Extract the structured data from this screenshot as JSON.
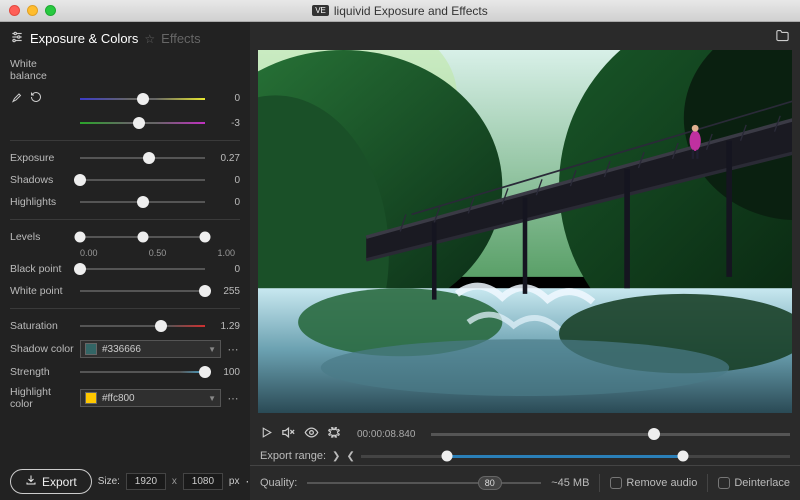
{
  "window": {
    "title": "liquivid Exposure and Effects",
    "badge": "VE"
  },
  "tabs": {
    "active": "Exposure & Colors",
    "inactive": "Effects"
  },
  "whiteBalance": {
    "label": "White balance",
    "temp_value": "0",
    "tint_value": "-3"
  },
  "exposure": {
    "label": "Exposure",
    "value": "0.27"
  },
  "shadows": {
    "label": "Shadows",
    "value": "0"
  },
  "highlights": {
    "label": "Highlights",
    "value": "0"
  },
  "levels": {
    "label": "Levels",
    "t0": "0.00",
    "t1": "0.50",
    "t2": "1.00"
  },
  "blackpoint": {
    "label": "Black point",
    "value": "0"
  },
  "whitepoint": {
    "label": "White point",
    "value": "255"
  },
  "saturation": {
    "label": "Saturation",
    "value": "1.29"
  },
  "shadowColor": {
    "label": "Shadow color",
    "hex": "#336666"
  },
  "strength": {
    "label": "Strength",
    "value": "100"
  },
  "highlightColor": {
    "label": "Highlight color",
    "hex": "#ffc800"
  },
  "export": {
    "button": "Export",
    "size_label": "Size:",
    "width": "1920",
    "height": "1080",
    "unit": "px"
  },
  "playback": {
    "timecode": "00:00:08.840"
  },
  "exportRange": {
    "label": "Export range:"
  },
  "quality": {
    "label": "Quality:",
    "value": "80",
    "size_est": "~45 MB"
  },
  "options": {
    "removeAudio": "Remove audio",
    "deinterlace": "Deinterlace"
  }
}
